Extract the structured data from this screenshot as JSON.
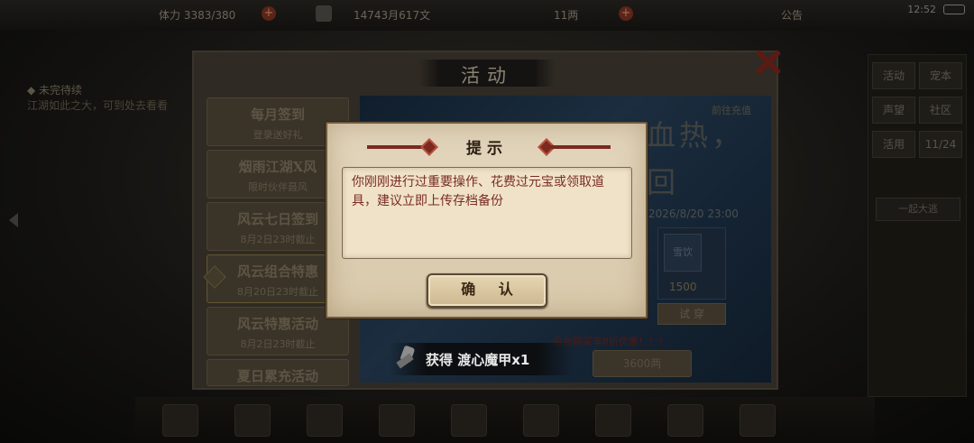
{
  "status_bar": {
    "stamina": "体力 3383/380",
    "copper": "14743月617文",
    "silver": "11两",
    "notice": "公告",
    "clock": "12:52"
  },
  "left_task": {
    "title": "◆ 未完待续",
    "desc": "江湖如此之大，可到处去看看"
  },
  "right_panel": {
    "buttons": [
      "活动",
      "宠本",
      "声望",
      "社区",
      "活用",
      "11/24"
    ],
    "wide_label": "一起大逃"
  },
  "activity_panel": {
    "title": "活动",
    "tabs": [
      {
        "title": "每月签到",
        "subtitle": "登录送好礼"
      },
      {
        "title": "烟雨江湖X风",
        "subtitle": "限时伙伴聂风"
      },
      {
        "title": "风云七日签到",
        "subtitle": "8月2日23时截止"
      },
      {
        "title": "风云组合特惠",
        "subtitle": "8月20日23时截止"
      },
      {
        "title": "风云特惠活动",
        "subtitle": "8月2日23时截止"
      },
      {
        "title": "夏日累充活动",
        "subtitle": ""
      }
    ],
    "banner": {
      "deco_text": "剑胆如血热，一刹轮回",
      "recharge_link": "前往充值",
      "deadline": "2026/8/20 23:00",
      "item_name": "雪饮",
      "item_price": "1500",
      "try_button": "试 穿",
      "promo": "组合购买享8折优惠！！！",
      "price_button": "3600两"
    }
  },
  "dialog": {
    "title": "提示",
    "message": "你刚刚进行过重要操作、花费过元宝或领取道具，建议立即上传存档备份",
    "confirm": "确 认"
  },
  "toast": {
    "text": "获得 渡心魔甲x1"
  },
  "colors": {
    "dialog_bg": "#e3d6bd",
    "message_text": "#7a2c24",
    "ornament": "#7a2a20"
  }
}
